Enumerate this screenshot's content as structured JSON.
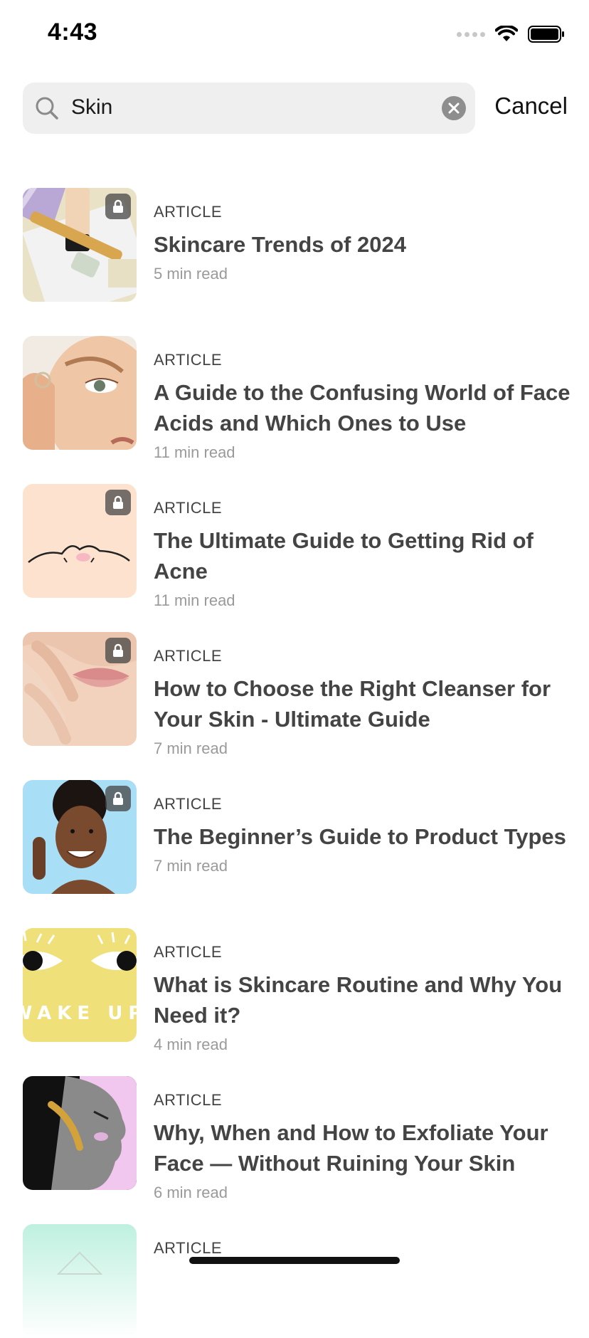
{
  "status_bar": {
    "time": "4:43",
    "icons": [
      "cellular-signal-icon",
      "wifi-icon",
      "battery-icon"
    ]
  },
  "search": {
    "value": "Skin",
    "cancel_label": "Cancel"
  },
  "results": [
    {
      "type": "ARTICLE",
      "title": "Skincare Trends of 2024",
      "meta": "5 min read",
      "locked": true,
      "thumb": "cosmetics-flatlay"
    },
    {
      "type": "ARTICLE",
      "title": "A Guide to the Confusing World of Face Acids and Which Ones to Use",
      "meta": "11 min read",
      "locked": false,
      "thumb": "face-closeup"
    },
    {
      "type": "ARTICLE",
      "title": "The Ultimate Guide to Getting Rid of Acne",
      "meta": "11 min read",
      "locked": true,
      "thumb": "acne-illustration"
    },
    {
      "type": "ARTICLE",
      "title": "How to Choose the Right Cleanser for Your Skin - Ultimate Guide",
      "meta": "7 min read",
      "locked": true,
      "thumb": "lips-closeup"
    },
    {
      "type": "ARTICLE",
      "title": "The Beginner’s Guide to Product Types",
      "meta": "7 min read",
      "locked": true,
      "thumb": "smiling-woman"
    },
    {
      "type": "ARTICLE",
      "title": "What is Skincare Routine and Why You Need it?",
      "meta": "4 min read",
      "locked": false,
      "thumb": "wake-up-illustration",
      "thumb_text": "WAKE UP"
    },
    {
      "type": "ARTICLE",
      "title": "Why, When and How to Exfoliate Your Face — Without Ruining Your Skin",
      "meta": "6 min read",
      "locked": false,
      "thumb": "profile-portrait"
    },
    {
      "type": "ARTICLE",
      "title": "",
      "meta": "",
      "locked": false,
      "thumb": "mint-illustration"
    }
  ],
  "colors": {
    "search_bg": "#efefef",
    "title": "#444444",
    "meta": "#9a9a9a",
    "lock_badge": "#464646"
  }
}
